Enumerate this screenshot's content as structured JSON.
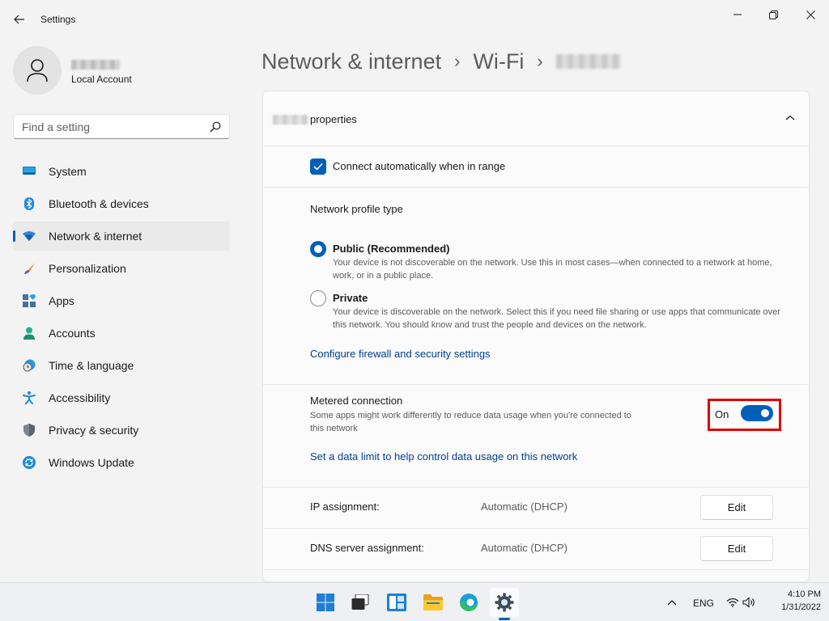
{
  "window": {
    "app_title": "Settings"
  },
  "account": {
    "type": "Local Account"
  },
  "search": {
    "placeholder": "Find a setting"
  },
  "sidebar": {
    "items": [
      {
        "label": "System",
        "icon": "monitor-icon"
      },
      {
        "label": "Bluetooth & devices",
        "icon": "bluetooth-icon"
      },
      {
        "label": "Network & internet",
        "icon": "wifi-icon",
        "selected": true
      },
      {
        "label": "Personalization",
        "icon": "brush-icon"
      },
      {
        "label": "Apps",
        "icon": "apps-icon"
      },
      {
        "label": "Accounts",
        "icon": "person-icon"
      },
      {
        "label": "Time & language",
        "icon": "clock-globe-icon"
      },
      {
        "label": "Accessibility",
        "icon": "accessibility-icon"
      },
      {
        "label": "Privacy & security",
        "icon": "shield-icon"
      },
      {
        "label": "Windows Update",
        "icon": "update-icon"
      }
    ]
  },
  "breadcrumb": {
    "level1": "Network & internet",
    "level2": "Wi-Fi",
    "separator": "›"
  },
  "properties": {
    "header": "properties",
    "auto_connect_label": "Connect automatically when in range",
    "auto_connect_checked": true,
    "profile_section_title": "Network profile type",
    "profile_options": [
      {
        "title": "Public (Recommended)",
        "description": "Your device is not discoverable on the network. Use this in most cases—when connected to a network at home, work, or in a public place.",
        "selected": true
      },
      {
        "title": "Private",
        "description": "Your device is discoverable on the network. Select this if you need file sharing or use apps that communicate over this network. You should know and trust the people and devices on the network.",
        "selected": false
      }
    ],
    "firewall_link": "Configure firewall and security settings",
    "metered": {
      "title": "Metered connection",
      "description": "Some apps might work differently to reduce data usage when you're connected to this network",
      "toggle_label": "On",
      "toggle_on": true
    },
    "data_limit_link": "Set a data limit to help control data usage on this network",
    "ip_assignment": {
      "label": "IP assignment:",
      "value": "Automatic (DHCP)",
      "button": "Edit"
    },
    "dns_assignment": {
      "label": "DNS server assignment:",
      "value": "Automatic (DHCP)",
      "button": "Edit"
    }
  },
  "taskbar": {
    "language": "ENG",
    "time": "4:10 PM",
    "date": "1/31/2022"
  },
  "colors": {
    "accent": "#005fb8",
    "link": "#003e92",
    "highlight_box": "#e00000"
  }
}
